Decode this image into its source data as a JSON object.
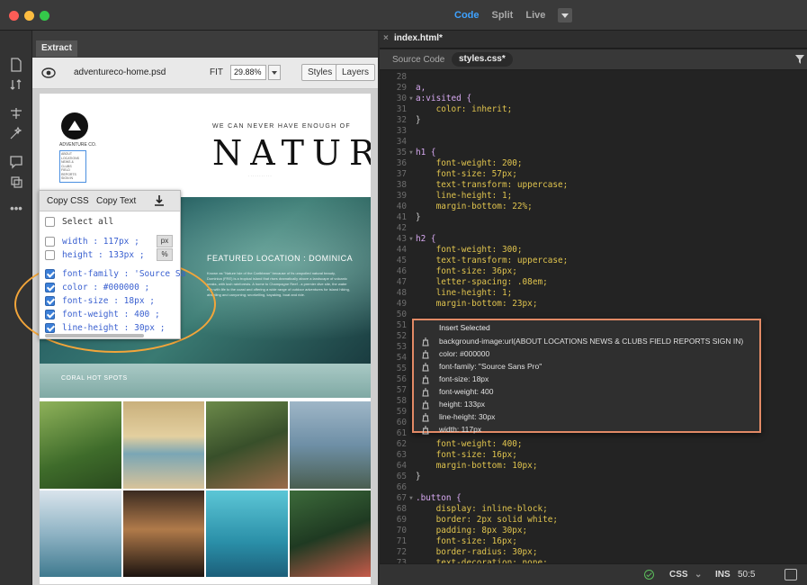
{
  "titlebar": {
    "modes": [
      "Code",
      "Split",
      "Live"
    ],
    "active_mode": "Code"
  },
  "extract": {
    "tab_label": "Extract",
    "psd_name": "adventureco-home.psd",
    "fit_label": "FIT",
    "zoom_value": "29.88%",
    "styles_button": "Styles",
    "layers_button": "Layers"
  },
  "psd": {
    "logo_text": "ADVENTURE CO.",
    "nav_items": [
      "ABOUT",
      "LOCATIONS",
      "NEWS & CLUBS",
      "FIELD REPORTS",
      "SIGN IN"
    ],
    "tagline": "WE CAN NEVER HAVE ENOUGH OF",
    "headline": "NATURE",
    "hero_title": "FEATURED LOCATION : DOMINICA",
    "hero_body": "Known as \"Nature Isle of the Caribbean\" because of its unspoiled natural beauty, Dominica (FRE) is a tropical island that rises dramatically above a landscape of volcanic peaks, with lush rainforests. A home to Champagne Reef - a premier dive site, the water rich with life to the coast and offering a wide range of outdoor adventures for island hiking, abseiling and canyoning; snorkelling, kayaking, boat and ride.",
    "section_title": "CORAL HOT SPOTS"
  },
  "popup": {
    "copy_css": "Copy CSS",
    "copy_text": "Copy Text",
    "select_all": "Select all",
    "properties": [
      {
        "name": "width",
        "value": "117px",
        "checked": false,
        "unit": "px"
      },
      {
        "name": "height",
        "value": "133px",
        "checked": false,
        "unit": "%"
      },
      {
        "name": "font-family",
        "value": "'Source Sa",
        "checked": true
      },
      {
        "name": "color",
        "value": "#000000",
        "checked": true
      },
      {
        "name": "font-size",
        "value": "18px",
        "checked": true
      },
      {
        "name": "font-weight",
        "value": "400",
        "checked": true
      },
      {
        "name": "line-height",
        "value": "30px",
        "checked": true
      }
    ]
  },
  "editor": {
    "doc_tab": "index.html*",
    "source_code_label": "Source Code",
    "css_tab": "styles.css*",
    "code_lines": [
      {
        "n": "28",
        "t": ""
      },
      {
        "n": "29",
        "t": "a,"
      },
      {
        "n": "30",
        "fold": true,
        "t": "a:visited {"
      },
      {
        "n": "31",
        "t": "    color: inherit;"
      },
      {
        "n": "32",
        "t": "}"
      },
      {
        "n": "33",
        "t": ""
      },
      {
        "n": "34",
        "t": ""
      },
      {
        "n": "35",
        "fold": true,
        "t": "h1 {"
      },
      {
        "n": "36",
        "t": "    font-weight: 200;"
      },
      {
        "n": "37",
        "t": "    font-size: 57px;"
      },
      {
        "n": "38",
        "t": "    text-transform: uppercase;"
      },
      {
        "n": "39",
        "t": "    line-height: 1;"
      },
      {
        "n": "40",
        "t": "    margin-bottom: 22%;"
      },
      {
        "n": "41",
        "t": "}"
      },
      {
        "n": "42",
        "t": ""
      },
      {
        "n": "43",
        "fold": true,
        "t": "h2 {"
      },
      {
        "n": "44",
        "t": "    font-weight: 300;"
      },
      {
        "n": "45",
        "t": "    text-transform: uppercase;"
      },
      {
        "n": "46",
        "t": "    font-size: 36px;"
      },
      {
        "n": "47",
        "t": "    letter-spacing: .08em;"
      },
      {
        "n": "48",
        "t": "    line-height: 1;"
      },
      {
        "n": "49",
        "t": "    margin-bottom: 23px;"
      },
      {
        "n": "50",
        "t": ""
      },
      {
        "n": "51",
        "t": ""
      },
      {
        "n": "52",
        "t": ""
      },
      {
        "n": "53",
        "t": ""
      },
      {
        "n": "54",
        "t": ""
      },
      {
        "n": "55",
        "t": ""
      },
      {
        "n": "56",
        "t": ""
      },
      {
        "n": "57",
        "t": ""
      },
      {
        "n": "58",
        "t": ""
      },
      {
        "n": "59",
        "t": ""
      },
      {
        "n": "60",
        "t": ""
      },
      {
        "n": "61",
        "t": ""
      },
      {
        "n": "62",
        "t": "    font-weight: 400;"
      },
      {
        "n": "63",
        "t": "    font-size: 16px;"
      },
      {
        "n": "64",
        "t": "    margin-bottom: 10px;"
      },
      {
        "n": "65",
        "t": "}"
      },
      {
        "n": "66",
        "t": ""
      },
      {
        "n": "67",
        "fold": true,
        "t": ".button {"
      },
      {
        "n": "68",
        "t": "    display: inline-block;"
      },
      {
        "n": "69",
        "t": "    border: 2px solid white;"
      },
      {
        "n": "70",
        "t": "    padding: 8px 30px;"
      },
      {
        "n": "71",
        "t": "    font-size: 16px;"
      },
      {
        "n": "72",
        "t": "    border-radius: 30px;"
      },
      {
        "n": "73",
        "t": "    text-decoration: none;"
      }
    ],
    "hint": {
      "title": "Insert Selected",
      "items": [
        "background-image:url(ABOUT LOCATIONS NEWS & CLUBS FIELD REPORTS SIGN IN)",
        "color: #000000",
        "font-family: \"Source Sans Pro\"",
        "font-size: 18px",
        "font-weight: 400",
        "height: 133px",
        "line-height: 30px",
        "width: 117px"
      ]
    },
    "status": {
      "language": "CSS",
      "mode": "INS",
      "position": "50:5"
    }
  },
  "colors": {
    "accent": "#3ea2ff",
    "highlight_ring": "#f2a53a",
    "hint_border": "#e28a66"
  }
}
